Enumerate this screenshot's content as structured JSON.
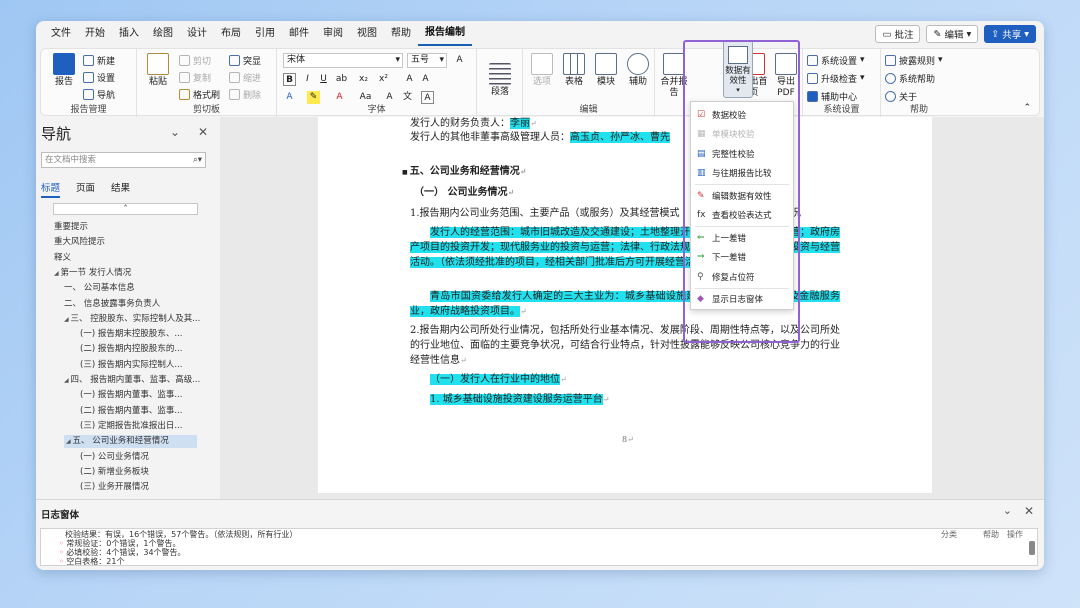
{
  "menu": [
    "文件",
    "开始",
    "插入",
    "绘图",
    "设计",
    "布局",
    "引用",
    "邮件",
    "审阅",
    "视图",
    "帮助",
    "报告编制"
  ],
  "top_buttons": {
    "comment": "批注",
    "edit": "编辑",
    "share": "共享"
  },
  "ribbon": {
    "report_mgmt": {
      "label": "报告管理",
      "report": "报告",
      "new": "新建",
      "settings": "设置",
      "export": "导航"
    },
    "clipboard": {
      "label": "剪切板",
      "paste": "粘贴",
      "cut": "剪切",
      "copy": "复制",
      "format_painter": "格式刷",
      "highlight": "突显",
      "unhide": "缩进",
      "delete": "删除"
    },
    "font": {
      "label": "字体",
      "font_name": "宋体",
      "font_size": "五号"
    },
    "paragraph": {
      "label": "段落"
    },
    "edit": {
      "label": "编辑",
      "select": "选项",
      "table": "表格",
      "module": "模块",
      "assist": "辅助"
    },
    "merge": {
      "label": "合并报告",
      "validity": "数据有效性",
      "export_front": "导出首页",
      "export_pdf": "导出PDF"
    },
    "system": {
      "label": "系统设置",
      "sys_settings": "系统设置",
      "upgrade": "升级检查",
      "help_center": "辅助中心"
    },
    "help": {
      "label": "帮助",
      "rules": "披露规则",
      "sys_help": "系统帮助",
      "about": "关于"
    }
  },
  "nav": {
    "title": "导航",
    "search_placeholder": "在文档中搜索",
    "tabs": [
      "标题",
      "页面",
      "结果"
    ],
    "items": [
      {
        "text": "重要提示",
        "level": 0
      },
      {
        "text": "重大风险提示",
        "level": 0
      },
      {
        "text": "释义",
        "level": 0
      },
      {
        "text": "第一节 发行人情况",
        "level": 0,
        "expanded": true
      },
      {
        "text": "一、 公司基本信息",
        "level": 1
      },
      {
        "text": "二、 信息披露事务负责人",
        "level": 1
      },
      {
        "text": "三、 控股股东、实际控制人及其...",
        "level": 1,
        "expanded": true
      },
      {
        "text": "(一) 报告期末控股股东、...",
        "level": 2
      },
      {
        "text": "(二) 报告期内控股股东的...",
        "level": 2
      },
      {
        "text": "(三) 报告期内实际控制人...",
        "level": 2
      },
      {
        "text": "四、 报告期内董事、监事、高级...",
        "level": 1,
        "expanded": true
      },
      {
        "text": "(一) 报告期内董事、监事...",
        "level": 2
      },
      {
        "text": "(二) 报告期内董事、监事...",
        "level": 2
      },
      {
        "text": "(三) 定期报告批准报出日...",
        "level": 2
      },
      {
        "text": "五、 公司业务和经营情况",
        "level": 1,
        "expanded": true,
        "selected": true
      },
      {
        "text": "(一) 公司业务情况",
        "level": 2
      },
      {
        "text": "(二) 新增业务板块",
        "level": 2
      },
      {
        "text": "(三) 业务开展情况",
        "level": 2
      }
    ]
  },
  "doc": {
    "line1_label": "发行人的财务负责人：",
    "line1_value": "李丽",
    "line2_label": "发行人的其他非董事高级管理人员：",
    "line2_value": "高玉贞、孙严冰、曹先",
    "section5": "五、公司业务和经营情况",
    "sub1": "（一）  公司业务情况",
    "p1": "1.报告期内公司业务范围、主要产品（或服务）及其经营模式",
    "p1_end": "况",
    "cyan_para1": "发行人的经营范围：城市旧城改造及交通建设；土地整理开发；基础设施建设与运营；政府房产项目的投资开发；现代服务业的投资与运营；法律、行政法规、法规禁止以外的其他投资与经营活动。（依法须经批准的项目，经相关部门批准后方可开展经营活动）。",
    "cyan_para2": "青岛市国资委给发行人确定的三大主业为：城乡基础设施建设与投资、资本运营及金融服务业，政府战略投资项目。",
    "p2": "2.报告期内公司所处行业情况，包括所处行业基本情况、发展阶段、周期性特点等，以及公司所处的行业地位、面临的主要竞争状况，可结合行业特点，针对性披露能够反映公司核心竞争力的行业经营性信息",
    "cyan_line3": "（一）发行人在行业中的地位",
    "cyan_line4": "1. 城乡基础设施投资建设服务运营平台",
    "page_number": "8"
  },
  "dropdown": {
    "items": [
      {
        "label": "数据校验",
        "enabled": true,
        "icon": "data-check-icon"
      },
      {
        "label": "单模块校验",
        "enabled": false,
        "icon": "single-module-check-icon"
      },
      {
        "label": "完整性校验",
        "enabled": true,
        "icon": "integrity-check-icon"
      },
      {
        "label": "与往期报告比较",
        "enabled": true,
        "icon": "compare-report-icon"
      },
      {
        "label": "编辑数据有效性",
        "enabled": true,
        "icon": "edit-validity-icon"
      },
      {
        "label": "查看校验表达式",
        "enabled": true,
        "icon": "fx-icon"
      },
      {
        "label": "上一差错",
        "enabled": true,
        "icon": "prev-error-icon"
      },
      {
        "label": "下一差错",
        "enabled": true,
        "icon": "next-error-icon"
      },
      {
        "label": "修复占位符",
        "enabled": true,
        "icon": "fix-placeholder-icon"
      },
      {
        "label": "显示日志窗体",
        "enabled": true,
        "icon": "show-log-icon"
      }
    ]
  },
  "log": {
    "title": "日志窗体",
    "lines": [
      "校验结果：有误，16个错误，57个警告。（依法规则，所有行业）",
      "常规验证：0个错误，1个警告。",
      "必填校验：4个错误，34个警告。",
      "空白表格：21个"
    ],
    "columns": [
      "分类",
      "帮助",
      "操作"
    ]
  },
  "colors": {
    "highlight": "#22e1ee",
    "accent": "#1f5fbf",
    "callout": "#8f63d6"
  }
}
